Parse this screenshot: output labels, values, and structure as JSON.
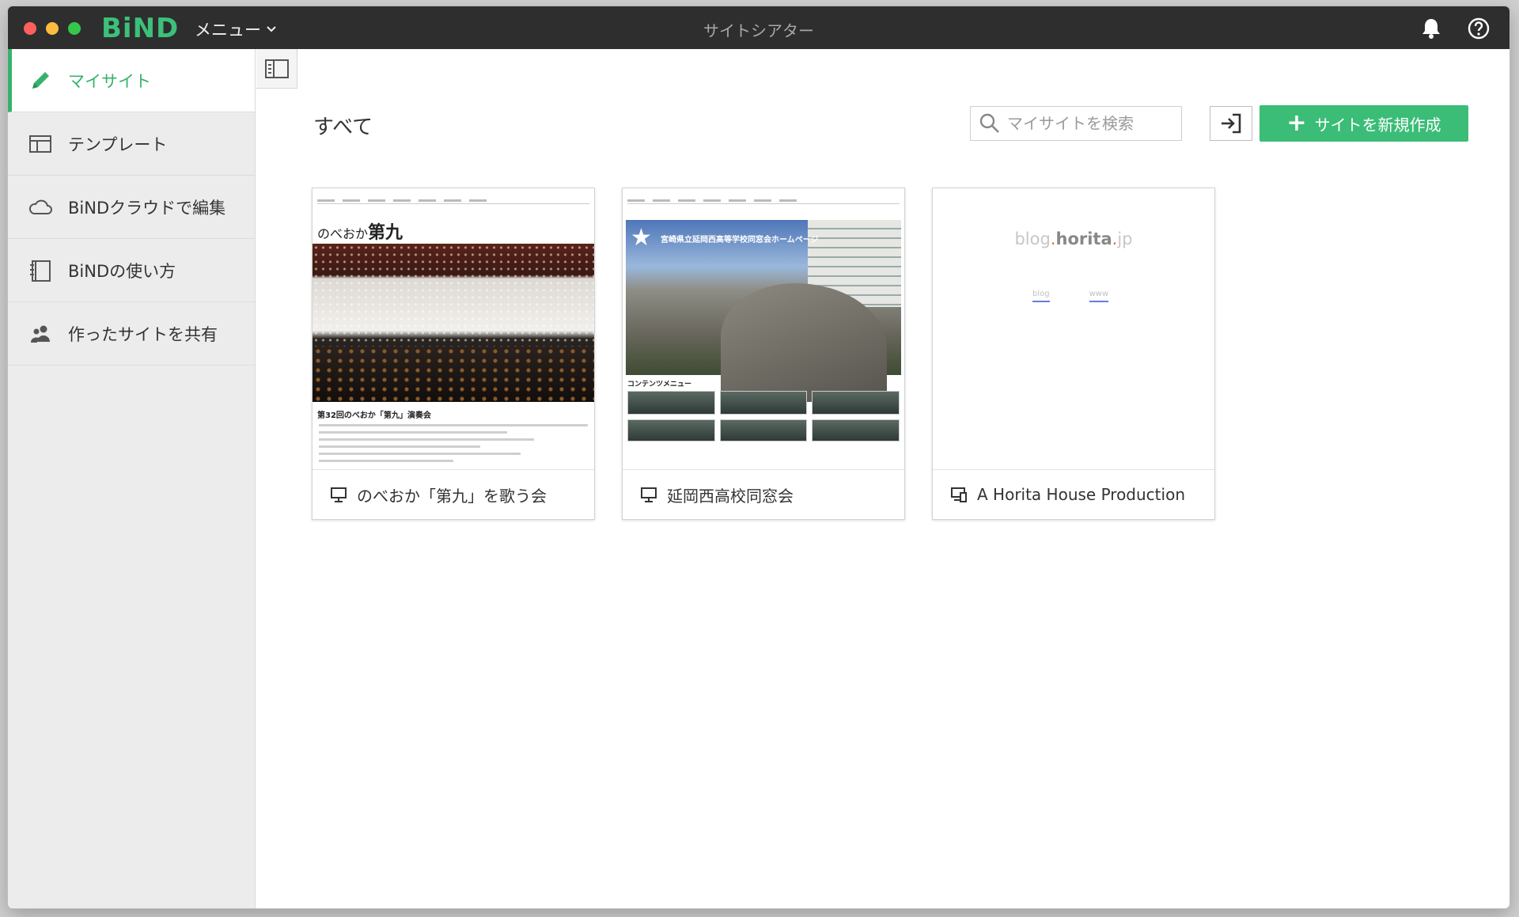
{
  "app": {
    "logo": "BiND",
    "menu_label": "メニュー",
    "window_title": "サイトシアター"
  },
  "sidebar": {
    "items": [
      {
        "label": "マイサイト",
        "icon": "pencil-icon",
        "active": true
      },
      {
        "label": "テンプレート",
        "icon": "template-icon",
        "active": false
      },
      {
        "label": "BiNDクラウドで編集",
        "icon": "cloud-icon",
        "active": false
      },
      {
        "label": "BiNDの使い方",
        "icon": "notebook-icon",
        "active": false
      },
      {
        "label": "作ったサイトを共有",
        "icon": "users-icon",
        "active": false
      }
    ]
  },
  "main": {
    "section_title": "すべて",
    "search": {
      "placeholder": "マイサイトを検索",
      "value": ""
    },
    "new_site_label": "サイトを新規作成",
    "sites": [
      {
        "name": "のべおか「第九」を歌う会",
        "thumb_heading_prefix": "のべおか",
        "thumb_heading_bold": "第九",
        "thumb_sub": "第32回のべおか「第九」演奏会"
      },
      {
        "name": "延岡西高校同窓会",
        "thumb_title": "宮崎県立延岡西高等学校同窓会ホームページ",
        "thumb_menu": "コンテンツメニュー"
      },
      {
        "name": "A Horita House Production",
        "thumb_logo_a": "blog",
        "thumb_logo_dot": ".",
        "thumb_logo_b": "horita",
        "thumb_logo_dot2": ".",
        "thumb_logo_c": "jp",
        "thumb_links": [
          "blog",
          "www"
        ]
      }
    ]
  },
  "colors": {
    "accent": "#3bbd77",
    "titlebar": "#2e2e2e",
    "sidebar_bg": "#ececec"
  }
}
